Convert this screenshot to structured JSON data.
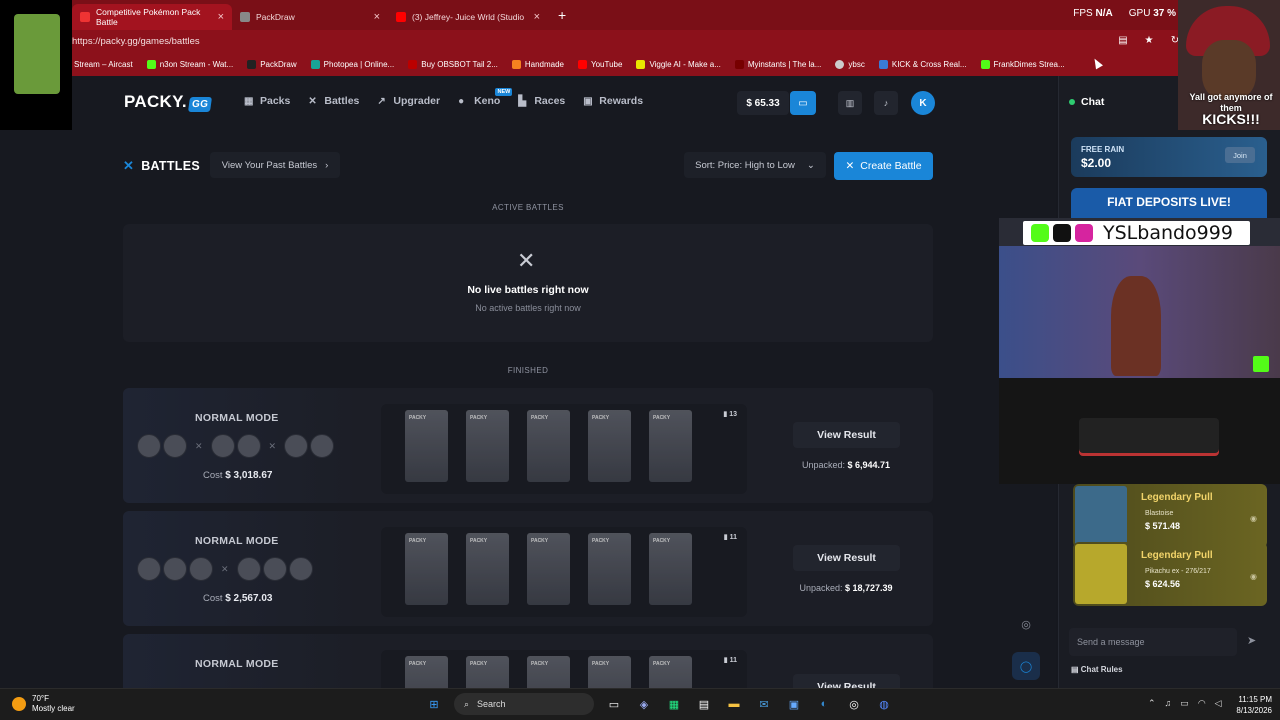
{
  "browser": {
    "tabs": [
      {
        "label": "Competitive Pokémon Pack Battle",
        "active": true
      },
      {
        "label": "PackDraw",
        "active": false
      },
      {
        "label": "(3) Jeffrey- Juice Wrld (Studio",
        "active": false
      }
    ],
    "new_tab": "+",
    "stats": {
      "fps_label": "FPS",
      "fps_value": "N/A",
      "gpu_label": "GPU",
      "gpu_value": "37 %"
    },
    "url": "https://packy.gg/games/battles",
    "bookmarks": [
      "Stream – Aircast",
      "n3on Stream - Wat...",
      "PackDraw",
      "Photopea | Online...",
      "Buy OBSBOT Tail 2...",
      "Handmade",
      "YouTube",
      "Viggle AI - Make a...",
      "Myinstants | The la...",
      "ybsc",
      "KICK & Cross Real...",
      "FrankDimes Strea..."
    ]
  },
  "site": {
    "logo_text": "PACKY.",
    "logo_badge": "GG",
    "nav": [
      {
        "label": "Packs",
        "icon": "cards-icon"
      },
      {
        "label": "Battles",
        "icon": "swords-icon"
      },
      {
        "label": "Upgrader",
        "icon": "trend-up-icon"
      },
      {
        "label": "Keno",
        "icon": "ball-icon",
        "badge": "NEW"
      },
      {
        "label": "Races",
        "icon": "podium-icon"
      },
      {
        "label": "Rewards",
        "icon": "gift-icon"
      }
    ],
    "balance": "$ 65.33",
    "avatar_letter": "K"
  },
  "battles": {
    "title": "BATTLES",
    "past_button": "View Your Past Battles",
    "sort_label": "Sort: Price: High to Low",
    "create_button": "Create Battle",
    "active_label": "ACTIVE BATTLES",
    "empty_title": "No live battles right now",
    "empty_sub": "No active battles right now",
    "finished_label": "FINISHED",
    "cards": [
      {
        "mode": "NORMAL MODE",
        "cost_label": "Cost",
        "cost": "$ 3,018.67",
        "count": "13",
        "view": "View Result",
        "unpacked_label": "Unpacked:",
        "unpacked": "$ 6,944.71"
      },
      {
        "mode": "NORMAL MODE",
        "cost_label": "Cost",
        "cost": "$ 2,567.03",
        "count": "11",
        "view": "View Result",
        "unpacked_label": "Unpacked:",
        "unpacked": "$ 18,727.39"
      },
      {
        "mode": "NORMAL MODE",
        "cost_label": "",
        "cost": "",
        "count": "11",
        "view": "View Result",
        "unpacked_label": "",
        "unpacked": ""
      }
    ]
  },
  "chat": {
    "title": "Chat",
    "rain_label": "FREE RAIN",
    "rain_amount": "$2.00",
    "rain_join": "Join",
    "fiat_banner": "FIAT DEPOSITS LIVE!",
    "pulls": [
      {
        "title": "Legendary Pull",
        "name": "Blastoise",
        "price": "$ 571.48"
      },
      {
        "title": "Legendary Pull",
        "name": "Pikachu ex - 276/217",
        "price": "$ 624.56"
      }
    ],
    "placeholder": "Send a message",
    "rules": "Chat Rules"
  },
  "overlay": {
    "cam_caption_1": "Yall got anymore of them",
    "cam_caption_2": "KICKS!!!",
    "social_name": "YSLbando999"
  },
  "taskbar": {
    "temp": "70°F",
    "weather": "Mostly clear",
    "search": "Search",
    "time": "11:15 PM",
    "date": "8/13/2026"
  }
}
